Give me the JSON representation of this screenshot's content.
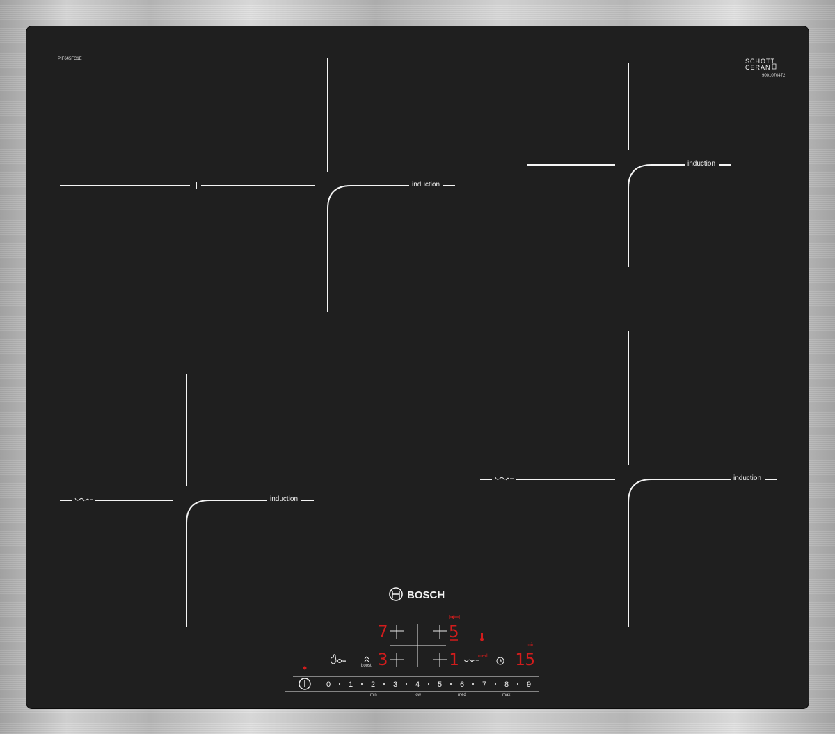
{
  "model": "PIF645FC1E",
  "logo": {
    "schott": "SCHOTT",
    "ceran": "CERAN",
    "serial": "9001070472"
  },
  "zones": {
    "front_left": {
      "label": "induction"
    },
    "rear_left": {
      "label": "induction"
    },
    "rear_right": {
      "label": "induction"
    },
    "front_right": {
      "label": "induction"
    }
  },
  "brand": "BOSCH",
  "displays": {
    "rear_left_level": "7",
    "rear_right_level": "5",
    "front_left_level": "3",
    "front_right_level": "1",
    "timer": "15"
  },
  "indicators": {
    "boost": "boost",
    "med": "med",
    "timer_unit": "min"
  },
  "slider": {
    "levels": [
      "0",
      "1",
      "2",
      "3",
      "4",
      "5",
      "6",
      "7",
      "8",
      "9"
    ],
    "sublabels": {
      "min": "min",
      "low": "low",
      "med": "med",
      "max": "max"
    }
  },
  "icons": {
    "power": "power-button-icon",
    "childlock": "child-lock-icon",
    "boost": "boost-icon",
    "frying": "frying-sensor-icon",
    "timer": "clock-icon",
    "temperature": "thermometer-icon",
    "transfer": "move-icon"
  }
}
